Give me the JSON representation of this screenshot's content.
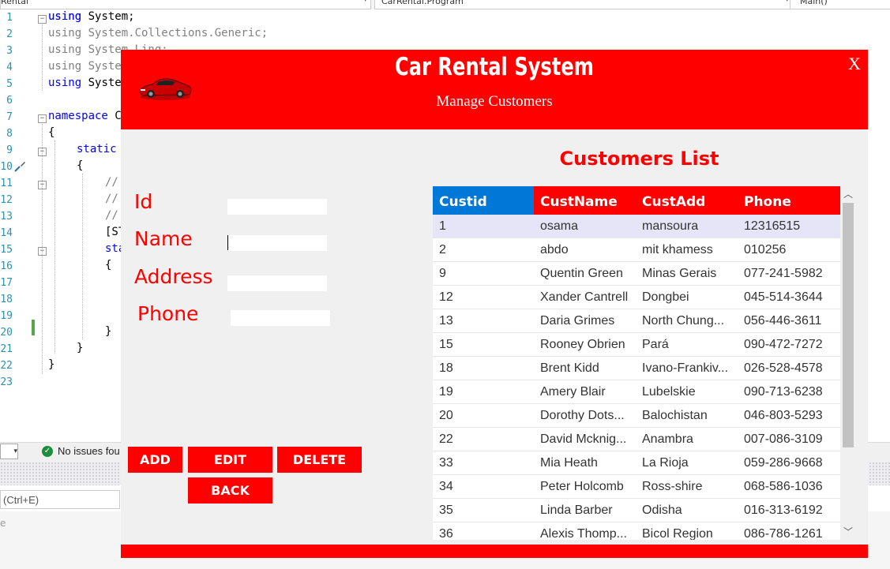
{
  "ide": {
    "combos": [
      "Rental",
      "CarRental.Program",
      "Main()"
    ],
    "line_numbers": [
      "1",
      "2",
      "3",
      "4",
      "5",
      "6",
      "7",
      "8",
      "9",
      "10",
      "11",
      "12",
      "13",
      "14",
      "15",
      "16",
      "17",
      "18",
      "19",
      "20",
      "21",
      "22",
      "23"
    ],
    "code": {
      "l1": "using System;",
      "l2": "using System.Collections.Generic;",
      "l3": "using System.Linq;",
      "l4": "using Syste",
      "l5": "using Syste",
      "l7": "namespace C",
      "l8": "{",
      "l9": "static",
      "l10": "{",
      "l11": "//",
      "l12": "//",
      "l13": "//",
      "l14": "[ST",
      "l15": "sta",
      "l16": "{",
      "l20": "}",
      "l21": "}",
      "l22": "}"
    },
    "status": "No issues fou",
    "search_placeholder": "(Ctrl+E)",
    "bottom_hint": "e"
  },
  "app": {
    "title": "Car Rental System",
    "subtitle": "Manage Customers",
    "close_label": "X",
    "form": {
      "id_label": "Id",
      "name_label": "Name",
      "address_label": "Address",
      "phone_label": "Phone",
      "id_value": "",
      "name_value": "",
      "address_value": "",
      "phone_value": ""
    },
    "buttons": {
      "add": "ADD",
      "edit": "EDIT",
      "delete": "DELETE",
      "back": "BACK"
    },
    "list_title": "Customers List",
    "grid": {
      "columns": [
        "Custid",
        "CustName",
        "CustAdd",
        "Phone"
      ],
      "rows": [
        [
          "1",
          "osama",
          "mansoura",
          "12316515"
        ],
        [
          "2",
          "abdo",
          "mit khamess",
          "010256"
        ],
        [
          "9",
          "Quentin Green",
          "Minas Gerais",
          "077-241-5982"
        ],
        [
          "12",
          "Xander Cantrell",
          "Dongbei",
          "045-514-3644"
        ],
        [
          "13",
          "Daria Grimes",
          "North Chung...",
          "056-446-3611"
        ],
        [
          "15",
          "Rooney Obrien",
          "Pará",
          "090-472-7272"
        ],
        [
          "18",
          "Brent Kidd",
          "Ivano-Frankiv...",
          "026-528-4578"
        ],
        [
          "19",
          "Amery Blair",
          "Lubelskie",
          "090-713-6238"
        ],
        [
          "20",
          "Dorothy Dots...",
          "Balochistan",
          "046-803-5293"
        ],
        [
          "22",
          "David Mcknig...",
          "Anambra",
          "007-086-3109"
        ],
        [
          "33",
          "Mia Heath",
          "La Rioja",
          "059-286-9668"
        ],
        [
          "34",
          "Peter Holcomb",
          "Ross-shire",
          "068-586-1036"
        ],
        [
          "35",
          "Linda Barber",
          "Odisha",
          "016-313-6192"
        ],
        [
          "36",
          "Alexis Thomp...",
          "Bicol Region",
          "086-786-1261"
        ]
      ]
    }
  },
  "colors": {
    "accent": "#ff0000",
    "selected_header": "#0078d7",
    "selected_row": "#e5e5f7"
  }
}
